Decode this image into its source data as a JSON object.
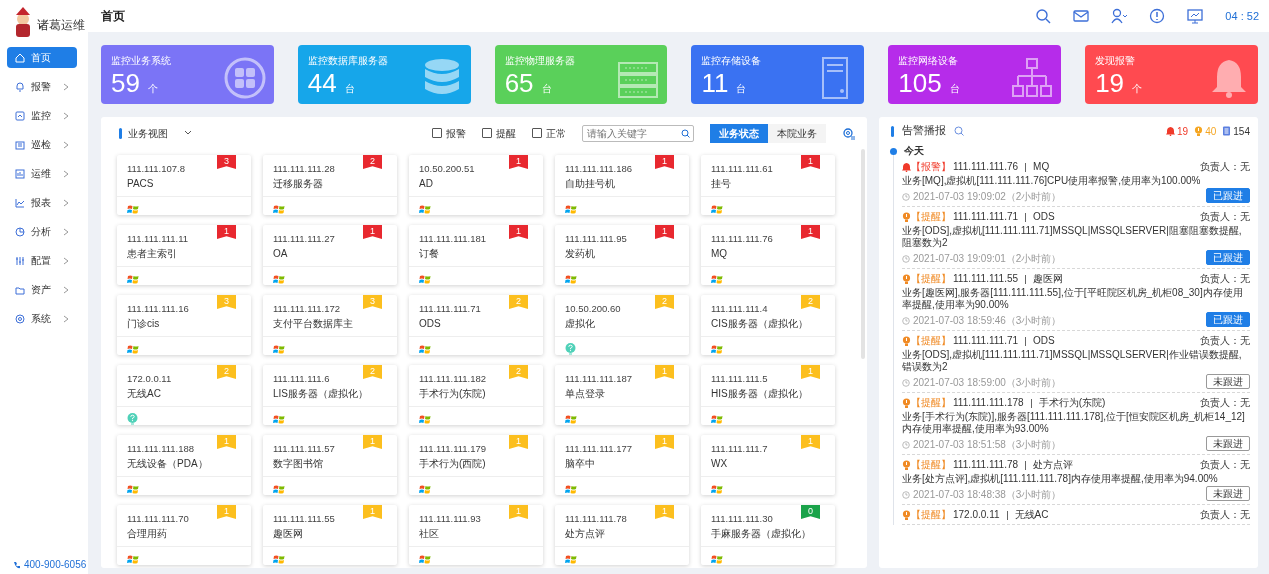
{
  "sidebar": {
    "logo_text": "诸葛运维",
    "items": [
      {
        "label": "首页",
        "selected": true,
        "expandable": false
      },
      {
        "label": "报警",
        "selected": false,
        "expandable": true
      },
      {
        "label": "监控",
        "selected": false,
        "expandable": true
      },
      {
        "label": "巡检",
        "selected": false,
        "expandable": true
      },
      {
        "label": "运维",
        "selected": false,
        "expandable": true
      },
      {
        "label": "报表",
        "selected": false,
        "expandable": true
      },
      {
        "label": "分析",
        "selected": false,
        "expandable": true
      },
      {
        "label": "配置",
        "selected": false,
        "expandable": true
      },
      {
        "label": "资产",
        "selected": false,
        "expandable": true
      },
      {
        "label": "系统",
        "selected": false,
        "expandable": true
      }
    ],
    "phone": "400-900-6056"
  },
  "header": {
    "title": "首页",
    "time": "04 : 52"
  },
  "stats": [
    {
      "label": "监控业务系统",
      "value": "59",
      "unit": "个",
      "color": "#7b74f6"
    },
    {
      "label": "监控数据库服务器",
      "value": "44",
      "unit": "台",
      "color": "#16a6ea"
    },
    {
      "label": "监控物理服务器",
      "value": "65",
      "unit": "台",
      "color": "#5ad05a"
    },
    {
      "label": "监控存储设备",
      "value": "11",
      "unit": "台",
      "color": "#3a72f2"
    },
    {
      "label": "监控网络设备",
      "value": "105",
      "unit": "台",
      "color": "#b62cea"
    },
    {
      "label": "发现报警",
      "value": "19",
      "unit": "个",
      "color": "#ff4a50"
    }
  ],
  "business_view": {
    "title": "业务视图",
    "filters": [
      {
        "label": "报警",
        "checked": false
      },
      {
        "label": "提醒",
        "checked": false
      },
      {
        "label": "正常",
        "checked": false
      }
    ],
    "search": {
      "placeholder": "请输入关键字"
    },
    "tabs": [
      {
        "label": "业务状态",
        "selected": true
      },
      {
        "label": "本院业务",
        "selected": false
      }
    ],
    "cards": [
      {
        "ip": "111.111.107.8",
        "name": "PACS",
        "count": "3",
        "color": "#e8282f",
        "kind": "windows"
      },
      {
        "ip": "111.111.111.28",
        "name": "迁移服务器",
        "count": "2",
        "color": "#e8282f",
        "kind": "windows"
      },
      {
        "ip": "10.50.200.51",
        "name": "AD",
        "count": "1",
        "color": "#e8282f",
        "kind": "windows"
      },
      {
        "ip": "111.111.111.186",
        "name": "自助挂号机",
        "count": "1",
        "color": "#e8282f",
        "kind": "windows"
      },
      {
        "ip": "111.111.111.61",
        "name": "挂号",
        "count": "1",
        "color": "#e8282f",
        "kind": "windows"
      },
      {
        "ip": "111.111.111.11",
        "name": "患者主索引",
        "count": "1",
        "color": "#e8282f",
        "kind": "windows"
      },
      {
        "ip": "111.111.111.27",
        "name": "OA",
        "count": "1",
        "color": "#e8282f",
        "kind": "windows"
      },
      {
        "ip": "111.111.111.181",
        "name": "订餐",
        "count": "1",
        "color": "#e8282f",
        "kind": "windows"
      },
      {
        "ip": "111.111.111.95",
        "name": "发药机",
        "count": "1",
        "color": "#e8282f",
        "kind": "windows"
      },
      {
        "ip": "111.111.111.76",
        "name": "MQ",
        "count": "1",
        "color": "#e8282f",
        "kind": "windows"
      },
      {
        "ip": "111.111.111.16",
        "name": "门诊cis",
        "count": "3",
        "color": "#fcbf1e",
        "kind": "windows"
      },
      {
        "ip": "111.111.111.172",
        "name": "支付平台数据库主",
        "count": "3",
        "color": "#fcbf1e",
        "kind": "windows"
      },
      {
        "ip": "111.111.111.71",
        "name": "ODS",
        "count": "2",
        "color": "#fcbf1e",
        "kind": "windows"
      },
      {
        "ip": "10.50.200.60",
        "name": "虚拟化",
        "count": "2",
        "color": "#fcbf1e",
        "kind": "unknown"
      },
      {
        "ip": "111.111.111.4",
        "name": "CIS服务器（虚拟化）",
        "count": "2",
        "color": "#fcbf1e",
        "kind": "windows"
      },
      {
        "ip": "172.0.0.11",
        "name": "无线AC",
        "count": "2",
        "color": "#fcbf1e",
        "kind": "unknown"
      },
      {
        "ip": "111.111.111.6",
        "name": "LIS服务器（虚拟化）",
        "count": "2",
        "color": "#fcbf1e",
        "kind": "windows"
      },
      {
        "ip": "111.111.111.182",
        "name": "手术行为(东院)",
        "count": "2",
        "color": "#fcbf1e",
        "kind": "windows"
      },
      {
        "ip": "111.111.111.187",
        "name": "单点登录",
        "count": "1",
        "color": "#fcbf1e",
        "kind": "windows"
      },
      {
        "ip": "111.111.111.5",
        "name": "HIS服务器（虚拟化）",
        "count": "1",
        "color": "#fcbf1e",
        "kind": "windows"
      },
      {
        "ip": "111.111.111.188",
        "name": "无线设备（PDA）",
        "count": "1",
        "color": "#fcbf1e",
        "kind": "windows"
      },
      {
        "ip": "111.111.111.57",
        "name": "数字图书馆",
        "count": "1",
        "color": "#fcbf1e",
        "kind": "windows"
      },
      {
        "ip": "111.111.111.179",
        "name": "手术行为(西院)",
        "count": "1",
        "color": "#fcbf1e",
        "kind": "windows"
      },
      {
        "ip": "111.111.111.177",
        "name": "脑卒中",
        "count": "1",
        "color": "#fcbf1e",
        "kind": "windows"
      },
      {
        "ip": "111.111.111.7",
        "name": "WX",
        "count": "1",
        "color": "#fcbf1e",
        "kind": "windows"
      },
      {
        "ip": "111.111.111.70",
        "name": "合理用药",
        "count": "1",
        "color": "#fcbf1e",
        "kind": "windows"
      },
      {
        "ip": "111.111.111.55",
        "name": "趣医网",
        "count": "1",
        "color": "#fcbf1e",
        "kind": "windows"
      },
      {
        "ip": "111.111.111.93",
        "name": "社区",
        "count": "1",
        "color": "#fcbf1e",
        "kind": "windows"
      },
      {
        "ip": "111.111.111.78",
        "name": "处方点评",
        "count": "1",
        "color": "#fcbf1e",
        "kind": "windows"
      },
      {
        "ip": "111.111.111.30",
        "name": "手麻服务器（虚拟化）",
        "count": "0",
        "color": "#1aa34a",
        "kind": "windows"
      }
    ]
  },
  "alerts": {
    "title": "告警播报",
    "alarm_count": "19",
    "reminder_count": "40",
    "total_count": "154",
    "day": "今天",
    "items": [
      {
        "kind": "alarm",
        "tag": "【报警】",
        "ip": "111.111.111.76",
        "system": "MQ",
        "owner": "负责人：无",
        "message": "业务[MQ],虚拟机[111.111.111.76]CPU使用率报警,使用率为100.00%",
        "time": "2021-07-03 19:09:02（2小时前）",
        "action": "已跟进",
        "followed": true
      },
      {
        "kind": "reminder",
        "tag": "【提醒】",
        "ip": "111.111.111.71",
        "system": "ODS",
        "owner": "负责人：无",
        "message": "业务[ODS],虚拟机[111.111.111.71]MSSQL|MSSQLSERVER|阻塞阻塞数提醒,阻塞数为2",
        "time": "2021-07-03 19:09:01（2小时前）",
        "action": "已跟进",
        "followed": true
      },
      {
        "kind": "reminder",
        "tag": "【提醒】",
        "ip": "111.111.111.55",
        "system": "趣医网",
        "owner": "负责人：无",
        "message": "业务[趣医网],服务器[111.111.111.55],位于[平旺院区机房_机柜08_30]内存使用率提醒,使用率为90.00%",
        "time": "2021-07-03 18:59:46（3小时前）",
        "action": "已跟进",
        "followed": true
      },
      {
        "kind": "reminder",
        "tag": "【提醒】",
        "ip": "111.111.111.71",
        "system": "ODS",
        "owner": "负责人：无",
        "message": "业务[ODS],虚拟机[111.111.111.71]MSSQL|MSSQLSERVER|作业错误数提醒,错误数为2",
        "time": "2021-07-03 18:59:00（3小时前）",
        "action": "未跟进",
        "followed": false
      },
      {
        "kind": "reminder",
        "tag": "【提醒】",
        "ip": "111.111.111.178",
        "system": "手术行为(东院)",
        "owner": "负责人：无",
        "message": "业务[手术行为(东院)],服务器[111.111.111.178],位于[恒安院区机房_机柜14_12]内存使用率提醒,使用率为93.00%",
        "time": "2021-07-03 18:51:58（3小时前）",
        "action": "未跟进",
        "followed": false
      },
      {
        "kind": "reminder",
        "tag": "【提醒】",
        "ip": "111.111.111.78",
        "system": "处方点评",
        "owner": "负责人：无",
        "message": "业务[处方点评],虚拟机[111.111.111.78]内存使用率提醒,使用率为94.00%",
        "time": "2021-07-03 18:48:38（3小时前）",
        "action": "未跟进",
        "followed": false
      },
      {
        "kind": "reminder",
        "tag": "【提醒】",
        "ip": "172.0.0.11",
        "system": "无线AC",
        "owner": "负责人：无"
      }
    ]
  }
}
